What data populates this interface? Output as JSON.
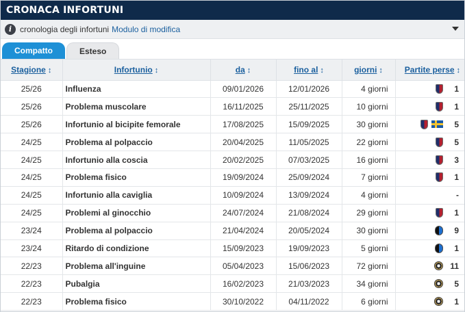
{
  "header": {
    "title": "CRONACA INFORTUNI"
  },
  "infobar": {
    "text": "cronologia degli infortuni",
    "link": "Modulo di modifica"
  },
  "tabs": [
    {
      "label": "Compatto"
    },
    {
      "label": "Esteso"
    }
  ],
  "columns": [
    {
      "label": "Stagione",
      "arrow": "↕"
    },
    {
      "label": "Infortunio",
      "arrow": "↕"
    },
    {
      "label": "da",
      "arrow": "↕"
    },
    {
      "label": "fino al",
      "arrow": "↕"
    },
    {
      "label": "giorni",
      "arrow": "↕"
    },
    {
      "label": "Partite perse",
      "arrow": "↕"
    }
  ],
  "rows": [
    {
      "season": "25/26",
      "injury": "Influenza",
      "from": "09/01/2026",
      "until": "12/01/2026",
      "days": "4 giorni",
      "clubs": [
        "bologna"
      ],
      "games": "1"
    },
    {
      "season": "25/26",
      "injury": "Problema muscolare",
      "from": "16/11/2025",
      "until": "25/11/2025",
      "days": "10 giorni",
      "clubs": [
        "bologna"
      ],
      "games": "1"
    },
    {
      "season": "25/26",
      "injury": "Infortunio al bicipite femorale",
      "from": "17/08/2025",
      "until": "15/09/2025",
      "days": "30 giorni",
      "clubs": [
        "bologna",
        "sweden"
      ],
      "games": "5"
    },
    {
      "season": "24/25",
      "injury": "Problema al polpaccio",
      "from": "20/04/2025",
      "until": "11/05/2025",
      "days": "22 giorni",
      "clubs": [
        "bologna"
      ],
      "games": "5"
    },
    {
      "season": "24/25",
      "injury": "Infortunio alla coscia",
      "from": "20/02/2025",
      "until": "07/03/2025",
      "days": "16 giorni",
      "clubs": [
        "bologna"
      ],
      "games": "3"
    },
    {
      "season": "24/25",
      "injury": "Problema fisico",
      "from": "19/09/2024",
      "until": "25/09/2024",
      "days": "7 giorni",
      "clubs": [
        "bologna"
      ],
      "games": "1"
    },
    {
      "season": "24/25",
      "injury": "Infortunio alla caviglia",
      "from": "10/09/2024",
      "until": "13/09/2024",
      "days": "4 giorni",
      "clubs": [],
      "games": "-"
    },
    {
      "season": "24/25",
      "injury": "Problemi al ginocchio",
      "from": "24/07/2024",
      "until": "21/08/2024",
      "days": "29 giorni",
      "clubs": [
        "bologna"
      ],
      "games": "1"
    },
    {
      "season": "23/24",
      "injury": "Problema al polpaccio",
      "from": "21/04/2024",
      "until": "20/05/2024",
      "days": "30 giorni",
      "clubs": [
        "atalanta"
      ],
      "games": "9"
    },
    {
      "season": "23/24",
      "injury": "Ritardo di condizione",
      "from": "15/09/2023",
      "until": "19/09/2023",
      "days": "5 giorni",
      "clubs": [
        "atalanta"
      ],
      "games": "1"
    },
    {
      "season": "22/23",
      "injury": "Problema all'inguine",
      "from": "05/04/2023",
      "until": "15/06/2023",
      "days": "72 giorni",
      "clubs": [
        "spezia"
      ],
      "games": "11"
    },
    {
      "season": "22/23",
      "injury": "Pubalgia",
      "from": "16/02/2023",
      "until": "21/03/2023",
      "days": "34 giorni",
      "clubs": [
        "spezia"
      ],
      "games": "5"
    },
    {
      "season": "22/23",
      "injury": "Problema fisico",
      "from": "30/10/2022",
      "until": "04/11/2022",
      "days": "6 giorni",
      "clubs": [
        "spezia"
      ],
      "games": "1"
    }
  ]
}
